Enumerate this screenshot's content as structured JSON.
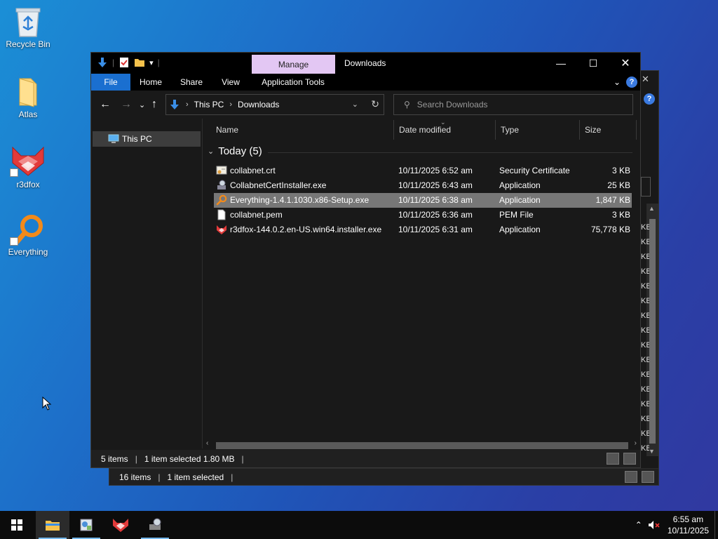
{
  "desktop": {
    "icons": [
      {
        "label": "Recycle Bin"
      },
      {
        "label": "Atlas"
      },
      {
        "label": "r3dfox"
      },
      {
        "label": "Everything"
      }
    ]
  },
  "back_window": {
    "status_items": "16 items",
    "status_selected": "1 item selected",
    "kb_fragment": "KB"
  },
  "window": {
    "manage_label": "Manage",
    "title": "Downloads",
    "ribbon_tabs": [
      "File",
      "Home",
      "Share",
      "View",
      "Application Tools"
    ],
    "address": {
      "root": "This PC",
      "folder": "Downloads"
    },
    "search_placeholder": "Search Downloads",
    "nav_item": "This PC",
    "columns": [
      "Name",
      "Date modified",
      "Type",
      "Size"
    ],
    "group_label": "Today (5)",
    "files": [
      {
        "name": "collabnet.crt",
        "date": "10/11/2025 6:52 am",
        "type": "Security Certificate",
        "size": "3 KB",
        "icon": "certificate-icon"
      },
      {
        "name": "CollabnetCertInstaller.exe",
        "date": "10/11/2025 6:43 am",
        "type": "Application",
        "size": "25 KB",
        "icon": "installer-icon"
      },
      {
        "name": "Everything-1.4.1.1030.x86-Setup.exe",
        "date": "10/11/2025 6:38 am",
        "type": "Application",
        "size": "1,847 KB",
        "icon": "everything-icon",
        "selected": true
      },
      {
        "name": "collabnet.pem",
        "date": "10/11/2025 6:36 am",
        "type": "PEM File",
        "size": "3 KB",
        "icon": "file-icon"
      },
      {
        "name": "r3dfox-144.0.2.en-US.win64.installer.exe",
        "date": "10/11/2025 6:31 am",
        "type": "Application",
        "size": "75,778 KB",
        "icon": "r3dfox-icon"
      }
    ],
    "status": {
      "count": "5 items",
      "selected": "1 item selected  1.80 MB"
    }
  },
  "taskbar": {
    "time": "6:55 am",
    "date": "10/11/2025"
  },
  "colors": {
    "file_tab": "#1a6fd0",
    "manage_tab": "#e3c7f3",
    "selection": "#777777",
    "taskbar": "#0c0c0c"
  }
}
